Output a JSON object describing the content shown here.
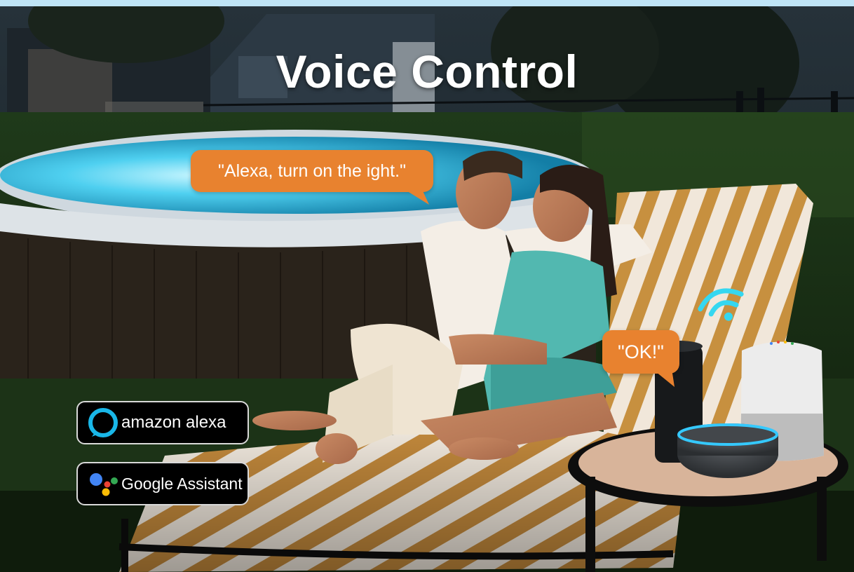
{
  "title": "Voice Control",
  "speech": {
    "alexa_command": "\"Alexa, turn on the ight.\"",
    "device_reply": "\"OK!\""
  },
  "badges": {
    "alexa": {
      "label": "amazon alexa",
      "icon": "alexa-ring-icon"
    },
    "google": {
      "label": "Google Assistant",
      "icon": "google-assistant-icon"
    }
  },
  "colors": {
    "bubble": "#e8822f",
    "alexa_blue": "#19b7e8",
    "wifi_cyan": "#35d7f0",
    "google_blue": "#4285f4",
    "google_red": "#ea4335",
    "google_yellow": "#fbbc05",
    "google_green": "#34a853"
  }
}
